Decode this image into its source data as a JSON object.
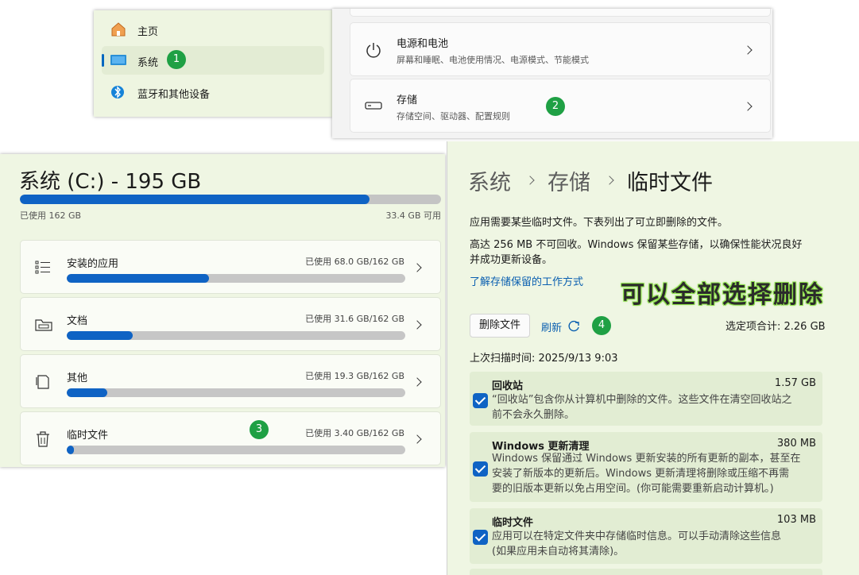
{
  "nav": {
    "items": [
      {
        "label": "主页",
        "icon": "home-icon"
      },
      {
        "label": "系统",
        "icon": "monitor-icon",
        "selected": true
      },
      {
        "label": "蓝牙和其他设备",
        "icon": "bluetooth-icon"
      }
    ],
    "badge": "1"
  },
  "settings": {
    "rows": [
      {
        "title": "电源和电池",
        "subtitle": "屏幕和睡眠、电池使用情况、电源模式、节能模式",
        "icon": "power-icon"
      },
      {
        "title": "存储",
        "subtitle": "存储空间、驱动器、配置规则",
        "icon": "drive-icon"
      }
    ],
    "badge": "2"
  },
  "storage": {
    "title": "系统 (C:) - 195 GB",
    "used_label": "已使用 162 GB",
    "free_label": "33.4 GB 可用",
    "used_fraction": 0.83,
    "categories": [
      {
        "name": "安装的应用",
        "usage": "已使用 68.0 GB/162 GB",
        "fraction": 0.42,
        "icon": "list-icon"
      },
      {
        "name": "文档",
        "usage": "已使用 31.6 GB/162 GB",
        "fraction": 0.195,
        "icon": "folder-icon"
      },
      {
        "name": "其他",
        "usage": "已使用 19.3 GB/162 GB",
        "fraction": 0.12,
        "icon": "file-icon"
      },
      {
        "name": "临时文件",
        "usage": "已使用 3.40 GB/162 GB",
        "fraction": 0.02,
        "icon": "trash-icon"
      }
    ],
    "badge": "3"
  },
  "temp": {
    "breadcrumb": [
      "系统",
      "存储",
      "临时文件"
    ],
    "intro": "应用需要某些临时文件。下表列出了可立即删除的文件。",
    "reserve_line1": "高达 256 MB 不可回收。Windows 保留某些存储，以确保性能状况良好",
    "reserve_line2": "并成功更新设备。",
    "learn_link": "了解存储保留的工作方式",
    "annotation": "可以全部选择删除",
    "delete_button": "删除文件",
    "refresh_label": "刷新",
    "badge": "4",
    "selected_total": "选定项合计: 2.26 GB",
    "last_scan": "上次扫描时间: 2025/9/13 9:03",
    "items": [
      {
        "name": "回收站",
        "size": "1.57 GB",
        "lines": [
          "“回收站”包含你从计算机中删除的文件。这些文件在清空回收站之",
          "前不会永久删除。"
        ]
      },
      {
        "name": "Windows 更新清理",
        "size": "380 MB",
        "lines": [
          "Windows 保留通过 Windows 更新安装的所有更新的副本，甚至在",
          "安装了新版本的更新后。Windows 更新清理将删除或压缩不再需",
          "要的旧版本更新以免占用空间。(你可能需要重新启动计算机。)"
        ]
      },
      {
        "name": "临时文件",
        "size": "103 MB",
        "lines": [
          "应用可以在特定文件夹中存储临时信息。可以手动清除这些信息",
          "(如果应用未自动将其清除)。"
        ]
      }
    ]
  }
}
